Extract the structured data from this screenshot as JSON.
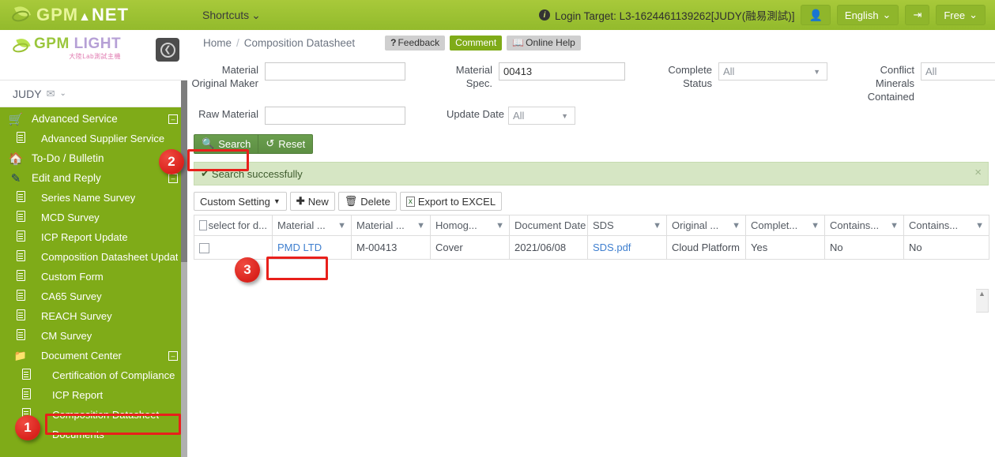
{
  "topbar": {
    "brand_gpm": "GPM",
    "brand_net": "NET",
    "shortcuts_label": "Shortcuts",
    "login_target": "Login Target: L3-1624461139262[JUDY(融易測試)]",
    "language_label": "English",
    "plan_label": "Free"
  },
  "sidebar": {
    "logo_line1_a": "GPM",
    "logo_line1_b": "LIGHT",
    "logo_line2": "大陸Lab測試主機",
    "user_name": "JUDY",
    "items": [
      {
        "label": "Advanced Service",
        "icon": "cart-icon",
        "level": 1,
        "expander": "minus"
      },
      {
        "label": "Advanced Supplier Service",
        "icon": "document-icon",
        "level": 2,
        "expander": ""
      },
      {
        "label": "To-Do / Bulletin",
        "icon": "home-icon",
        "level": 1,
        "expander": ""
      },
      {
        "label": "Edit and Reply",
        "icon": "pencil-icon",
        "level": 1,
        "expander": "minus"
      },
      {
        "label": "Series Name Survey",
        "icon": "document-icon",
        "level": 2,
        "expander": ""
      },
      {
        "label": "MCD Survey",
        "icon": "document-icon",
        "level": 2,
        "expander": ""
      },
      {
        "label": "ICP Report Update",
        "icon": "document-icon",
        "level": 2,
        "expander": ""
      },
      {
        "label": "Composition Datasheet Updat",
        "icon": "document-icon",
        "level": 2,
        "expander": ""
      },
      {
        "label": "Custom Form",
        "icon": "document-icon",
        "level": 2,
        "expander": ""
      },
      {
        "label": "CA65 Survey",
        "icon": "document-icon",
        "level": 2,
        "expander": ""
      },
      {
        "label": "REACH Survey",
        "icon": "document-icon",
        "level": 2,
        "expander": ""
      },
      {
        "label": "CM Survey",
        "icon": "document-icon",
        "level": 2,
        "expander": ""
      },
      {
        "label": "Document Center",
        "icon": "folder-icon",
        "level": 2,
        "expander": "minus"
      },
      {
        "label": "Certification of Compliance",
        "icon": "document-icon",
        "level": 3,
        "expander": ""
      },
      {
        "label": "ICP Report",
        "icon": "document-icon",
        "level": 3,
        "expander": ""
      },
      {
        "label": "Composition Datasheet",
        "icon": "document-icon",
        "level": 3,
        "expander": ""
      },
      {
        "label": "Documents",
        "icon": "document-icon",
        "level": 3,
        "expander": ""
      }
    ]
  },
  "breadcrumb": {
    "home": "Home",
    "separator": "/",
    "current": "Composition Datasheet",
    "feedback": "Feedback",
    "comment": "Comment",
    "online_help": "Online Help"
  },
  "search_form": {
    "material_original_maker_label": "Material Original Maker",
    "material_original_maker_value": "",
    "raw_material_label": "Raw Material",
    "raw_material_value": "",
    "material_spec_label": "Material Spec.",
    "material_spec_value": "00413",
    "update_date_label": "Update Date",
    "update_date_value": "All",
    "complete_status_label": "Complete Status",
    "complete_status_value": "All",
    "conflict_minerals_label": "Conflict Minerals Contained",
    "conflict_minerals_value": "All",
    "search_button": "Search",
    "reset_button": "Reset"
  },
  "alert": {
    "message": "Search successfully",
    "close": "×"
  },
  "toolbar": {
    "custom_setting": "Custom Setting",
    "new": "New",
    "delete": "Delete",
    "export": "Export to EXCEL"
  },
  "table": {
    "headers": [
      "select for d...",
      "Material ...",
      "Material ...",
      "Homog...",
      "Document Date",
      "SDS",
      "Original ...",
      "Complet...",
      "Contains...",
      "Contains..."
    ],
    "rows": [
      {
        "material_name": "PMD LTD",
        "material_code": "M-00413",
        "homogeneous": "Cover",
        "document_date": "2021/06/08",
        "sds": "SDS.pdf",
        "original": "Cloud Platform",
        "complete": "Yes",
        "contains_1": "No",
        "contains_2": "No"
      }
    ]
  },
  "annotations": {
    "marker_1": "1",
    "marker_2": "2",
    "marker_3": "3"
  },
  "colors": {
    "header_green": "#9dc233",
    "sidebar_green": "#7fab18",
    "accent_link": "#3f7fcf",
    "annotation_red": "#e8201b",
    "alert_bg": "#d6e6c4"
  }
}
